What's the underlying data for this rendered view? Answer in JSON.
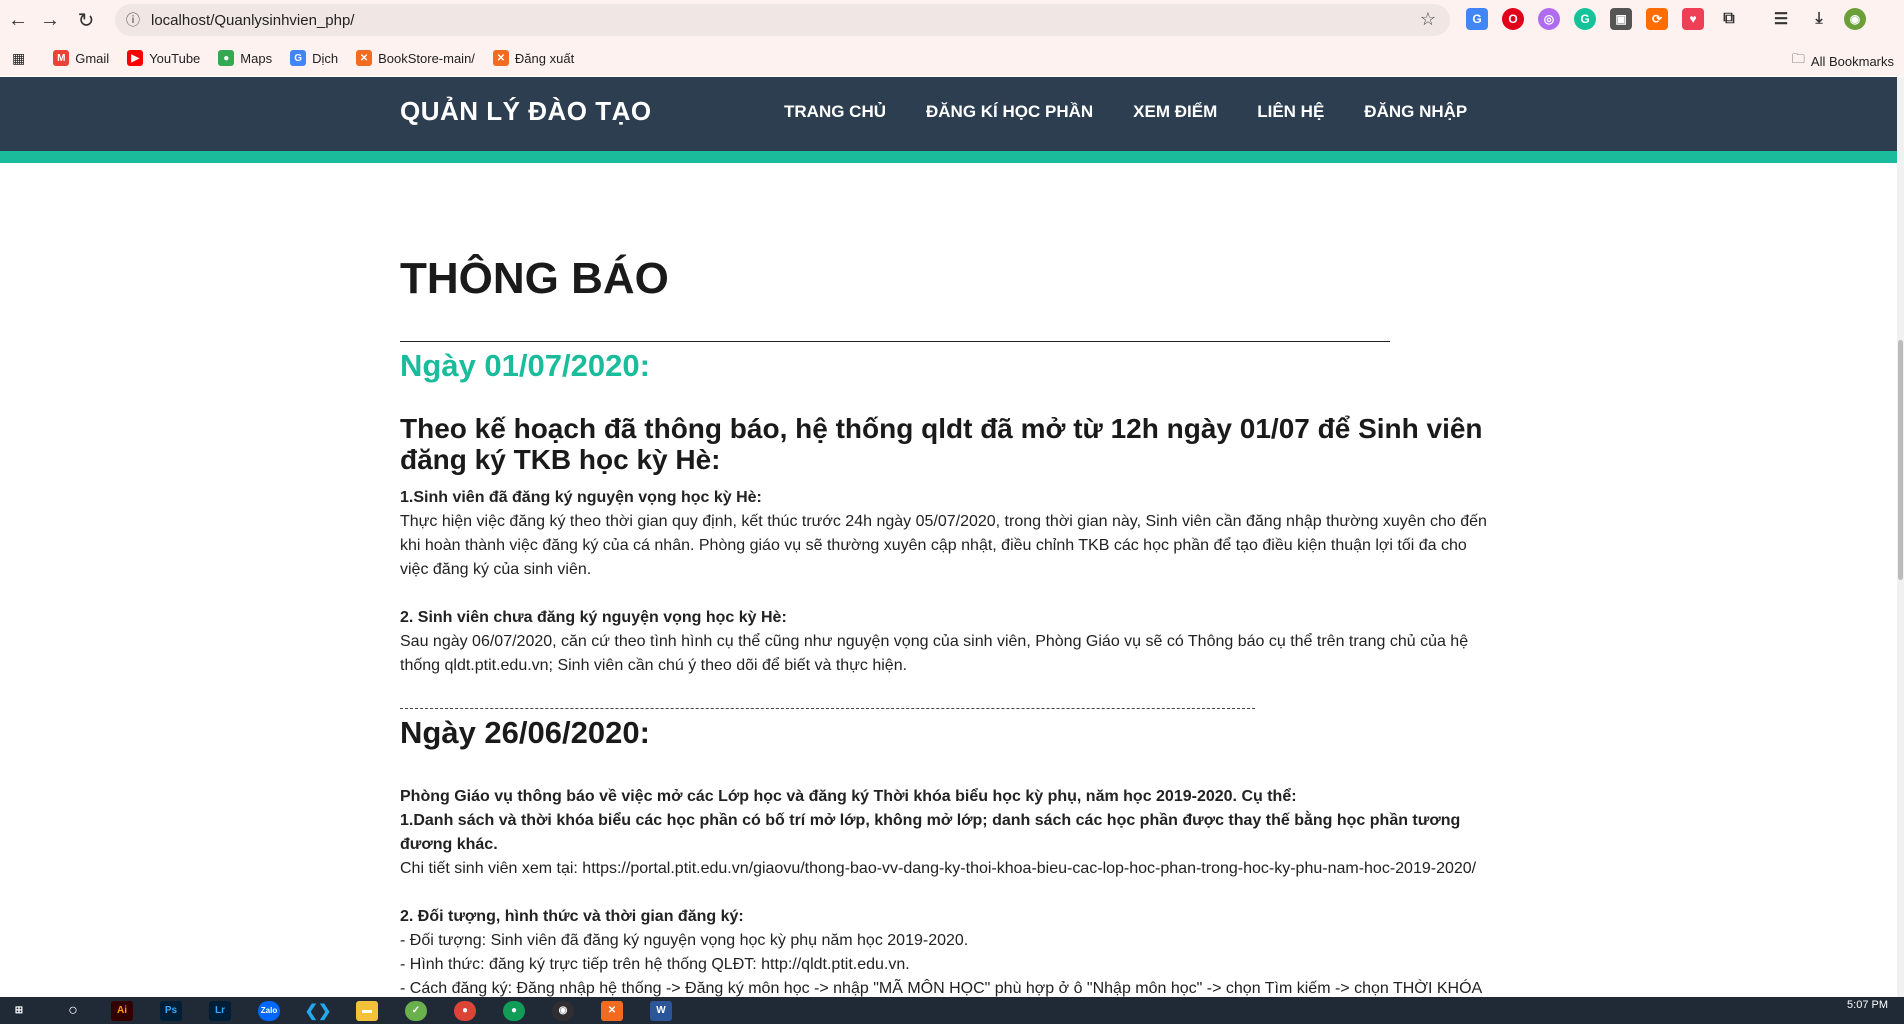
{
  "browser": {
    "url": "localhost/Quanlysinhvien_php/",
    "bookmarks": [
      {
        "label": "Gmail",
        "icon": "gmail-icon",
        "color": "#ea4335"
      },
      {
        "label": "YouTube",
        "icon": "youtube-icon",
        "color": "#ff0000"
      },
      {
        "label": "Maps",
        "icon": "maps-icon",
        "color": "#34a853"
      },
      {
        "label": "Dịch",
        "icon": "translate-icon",
        "color": "#4285f4"
      },
      {
        "label": "BookStore-main/",
        "icon": "xampp-icon",
        "color": "#f26b21"
      },
      {
        "label": "Đăng xuất",
        "icon": "xampp-icon",
        "color": "#f26b21"
      }
    ],
    "all_bookmarks": "All Bookmarks"
  },
  "site": {
    "brand": "QUẢN LÝ ĐÀO TẠO",
    "menu": [
      "TRANG CHỦ",
      "ĐĂNG KÍ HỌC PHẦN",
      "XEM ĐIỂM",
      "LIÊN HỆ",
      "ĐĂNG NHẬP"
    ],
    "header_color": "#2c3e50",
    "accent_color": "#1abc9c"
  },
  "content": {
    "title": "THÔNG BÁO",
    "notice1": {
      "date": "Ngày 01/07/2020:",
      "headline": "Theo kế hoạch đã thông báo, hệ thống qldt đã mở từ 12h ngày 01/07 để Sinh viên đăng ký TKB học kỳ Hè:",
      "s1_title": "1.Sinh viên đã đăng ký nguyện vọng học kỳ Hè:",
      "s1_text": "Thực hiện việc đăng ký theo thời gian quy định, kết thúc trước 24h ngày 05/07/2020, trong thời gian này, Sinh viên cần đăng nhập thường xuyên cho đến khi hoàn thành việc đăng ký của cá nhân. Phòng giáo vụ sẽ thường xuyên cập nhật, điều chỉnh TKB các học phần để tạo điều kiện thuận lợi tối đa cho việc đăng ký của sinh viên.",
      "s2_title": "2. Sinh viên chưa đăng ký nguyện vọng học kỳ Hè:",
      "s2_text": "Sau ngày 06/07/2020, căn cứ theo tình hình cụ thể cũng như nguyện vọng của sinh viên, Phòng Giáo vụ sẽ có Thông báo cụ thể trên trang chủ của hệ thống qldt.ptit.edu.vn; Sinh viên cần chú ý theo dõi để biết và thực hiện."
    },
    "notice2": {
      "date": "Ngày 26/06/2020:",
      "intro": "Phòng Giáo vụ thông báo về việc mở các Lớp học và đăng ký Thời khóa biểu học kỳ phụ, năm học 2019-2020. Cụ thể:",
      "s1_title": "1.Danh sách và thời khóa biểu các học phần có bố trí mở lớp, không mở lớp; danh sách các học phần được thay thế bằng học phần tương đương khác.",
      "s1_text": "Chi tiết sinh viên xem tại: https://portal.ptit.edu.vn/giaovu/thong-bao-vv-dang-ky-thoi-khoa-bieu-cac-lop-hoc-phan-trong-hoc-ky-phu-nam-hoc-2019-2020/",
      "s2_title": "2. Đối tượng, hình thức và thời gian đăng ký:",
      "s2_line1": "- Đối tượng: Sinh viên đã đăng ký nguyện vọng học kỳ phụ năm học 2019-2020.",
      "s2_line2": "- Hình thức: đăng ký trực tiếp trên hệ thống QLĐT: http://qldt.ptit.edu.vn.",
      "s2_line3": "- Cách đăng ký: Đăng nhập hệ thống -> Đăng ký môn học -> nhập \"MÃ MÔN HỌC\" phù hợp ở ô \"Nhập môn học\" -> chọn Tìm kiếm -> chọn THỜI KHÓA BIỂU"
    }
  },
  "taskbar": {
    "time": "5:07 PM"
  }
}
